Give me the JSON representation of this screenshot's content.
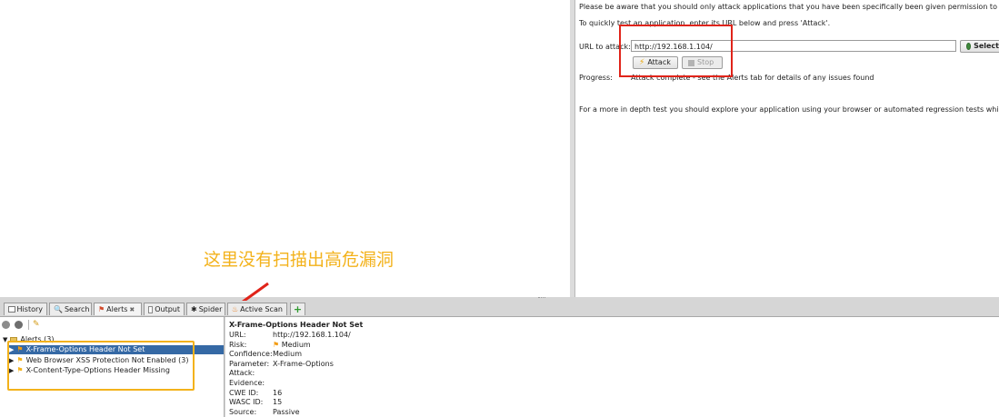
{
  "right_panel": {
    "notice": "Please be aware that you should only attack applications that you have been specifically been given permission to test.",
    "quick_test": "To quickly test an application, enter its URL below and press 'Attack'.",
    "url_label": "URL to attack:",
    "url_value": "http://192.168.1.104/",
    "select_label": "Select",
    "attack_label": "Attack",
    "stop_label": "Stop",
    "progress_label": "Progress:",
    "progress_value": "Attack complete - see the Alerts tab for details of any issues found",
    "in_depth": "For a more in depth test you should explore your application using your browser or automated regression tests while proxy"
  },
  "annotation": "这里没有扫描出高危漏洞",
  "tabs": [
    {
      "label": "History",
      "icon": "history-icon"
    },
    {
      "label": "Search",
      "icon": "search-icon"
    },
    {
      "label": "Alerts",
      "icon": "flag-icon"
    },
    {
      "label": "Output",
      "icon": "output-icon"
    },
    {
      "label": "Spider",
      "icon": "spider-icon"
    },
    {
      "label": "Active Scan",
      "icon": "fire-icon"
    }
  ],
  "alerts": {
    "root": "Alerts (3)",
    "items": [
      "X-Frame-Options Header Not Set",
      "Web Browser XSS Protection Not Enabled (3)",
      "X-Content-Type-Options Header Missing"
    ]
  },
  "detail": {
    "title": "X-Frame-Options Header Not Set",
    "rows": [
      {
        "key": "URL:",
        "value": "http://192.168.1.104/"
      },
      {
        "key": "Risk:",
        "value": "Medium"
      },
      {
        "key": "Confidence:",
        "value": "Medium"
      },
      {
        "key": "Parameter:",
        "value": "X-Frame-Options"
      },
      {
        "key": "Attack:",
        "value": ""
      },
      {
        "key": "Evidence:",
        "value": ""
      },
      {
        "key": "CWE ID:",
        "value": "16"
      },
      {
        "key": "WASC ID:",
        "value": "15"
      },
      {
        "key": "Source:",
        "value": "Passive"
      }
    ]
  },
  "colors": {
    "selection": "#3569a5",
    "red_highlight": "#e0241a",
    "orange_highlight": "#f3b21b",
    "flag": "#f39c12"
  }
}
